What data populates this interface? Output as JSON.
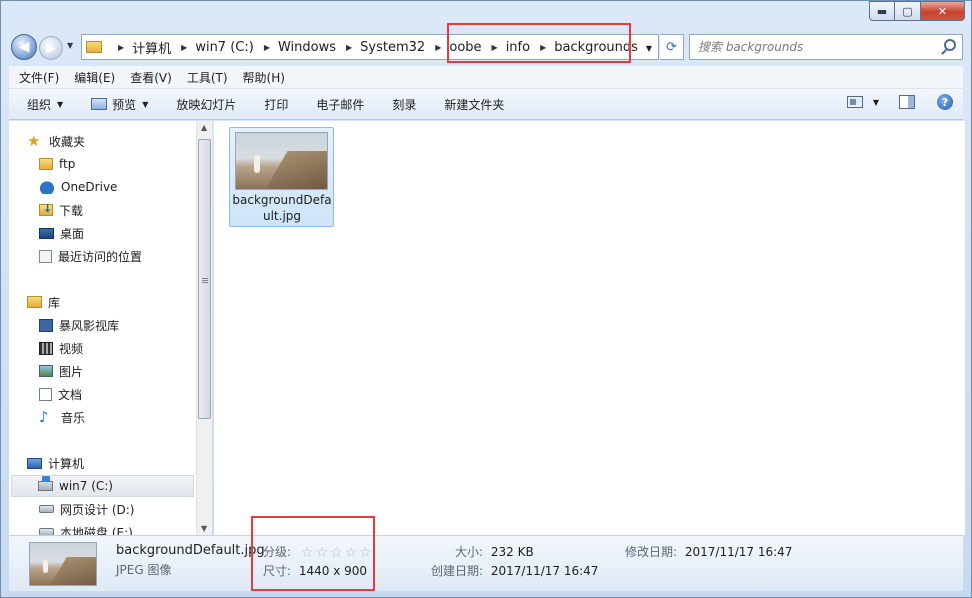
{
  "window": {
    "minimize": "▬",
    "maximize": "▢",
    "close": "✕"
  },
  "nav": {
    "back": "◀",
    "forward": "▶",
    "breadcrumb": [
      "计算机",
      "win7 (C:)",
      "Windows",
      "System32",
      "oobe",
      "info",
      "backgrounds"
    ],
    "search_placeholder": "搜索 backgrounds",
    "search_value": ""
  },
  "menubar": {
    "items": [
      "文件(F)",
      "编辑(E)",
      "查看(V)",
      "工具(T)",
      "帮助(H)"
    ]
  },
  "toolbar": {
    "organize": "组织",
    "preview": "预览",
    "slideshow": "放映幻灯片",
    "print": "打印",
    "email": "电子邮件",
    "burn": "刻录",
    "new_folder": "新建文件夹"
  },
  "navpane": {
    "favorites": "收藏夹",
    "ftp": "ftp",
    "onedrive": "OneDrive",
    "downloads": "下载",
    "desktop": "桌面",
    "recent": "最近访问的位置",
    "libraries": "库",
    "storm": "暴风影视库",
    "videos": "视频",
    "pictures": "图片",
    "documents": "文档",
    "music": "音乐",
    "computer": "计算机",
    "drive_c": "win7 (C:)",
    "drive_d": "网页设计 (D:)",
    "drive_e": "本地磁盘 (E:)"
  },
  "content": {
    "file_name": "backgroundDefault.jpg"
  },
  "details": {
    "name": "backgroundDefault.jpg",
    "type": "JPEG 图像",
    "rating_label": "分级:",
    "rating_value": 0,
    "dimensions_label": "尺寸:",
    "dimensions": "1440 x 900",
    "size_label": "大小:",
    "size": "232 KB",
    "created_label": "创建日期:",
    "created": "2017/11/17 16:47",
    "modified_label": "修改日期:",
    "modified": "2017/11/17 16:47"
  },
  "colors": {
    "highlight": "#e23c3c",
    "selection": "#cde4f9"
  }
}
